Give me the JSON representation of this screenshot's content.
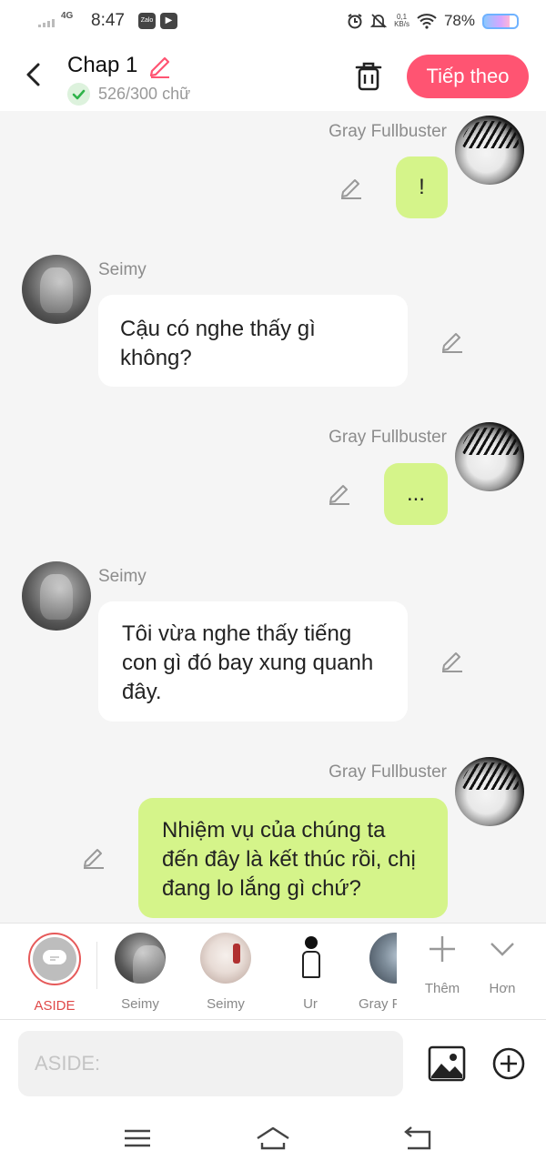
{
  "status_bar": {
    "network": "4G",
    "time": "8:47",
    "apps": [
      "Zalo",
      "▶"
    ],
    "data_rate_top": "0,1",
    "data_rate_unit": "KB/s",
    "battery": "78%"
  },
  "header": {
    "title": "Chap 1",
    "word_count": "526/300 chữ",
    "next_label": "Tiếp theo",
    "accent_color": "#ff5472"
  },
  "messages": [
    {
      "speaker": "Gray Fullbuster",
      "text": "!",
      "side": "right"
    },
    {
      "speaker": "Seimy",
      "text": "Cậu có nghe thấy gì không?",
      "side": "left"
    },
    {
      "speaker": "Gray Fullbuster",
      "text": "...",
      "side": "right"
    },
    {
      "speaker": "Seimy",
      "text": "Tôi vừa nghe thấy tiếng con gì đó bay xung quanh đây.",
      "side": "left"
    },
    {
      "speaker": "Gray Fullbuster",
      "text": "Nhiệm vụ của chúng ta đến đây là kết thúc rồi, chị đang lo lắng gì chứ?",
      "side": "right"
    }
  ],
  "characters": [
    {
      "label": "ASIDE",
      "icon": "aside-icon"
    },
    {
      "label": "Seimy",
      "icon": "avatar"
    },
    {
      "label": "Seimy",
      "icon": "avatar"
    },
    {
      "label": "Ur",
      "icon": "avatar"
    },
    {
      "label": "Gray F",
      "icon": "avatar"
    }
  ],
  "tools": {
    "add_label": "Thêm",
    "more_label": "Hơn"
  },
  "composer": {
    "placeholder": "ASIDE:"
  },
  "colors": {
    "bubble_right": "#d5f48a",
    "bubble_left": "#ffffff",
    "chat_background": "#f5f5f5"
  }
}
